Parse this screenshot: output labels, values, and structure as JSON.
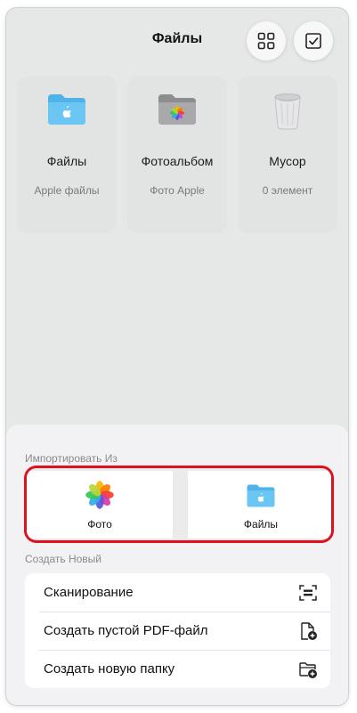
{
  "header": {
    "title": "Файлы"
  },
  "cards": [
    {
      "name": "Файлы",
      "sub": "Apple файлы"
    },
    {
      "name": "Фотоальбом",
      "sub": "Фото Apple"
    },
    {
      "name": "Мусор",
      "sub": "0 элемент"
    }
  ],
  "sheet": {
    "import_label": "Импортировать Из",
    "import_items": [
      {
        "label": "Фото"
      },
      {
        "label": "Файлы"
      }
    ],
    "create_label": "Создать Новый",
    "create_items": [
      {
        "label": "Сканирование",
        "icon": "scan-icon"
      },
      {
        "label": "Создать пустой PDF-файл",
        "icon": "add-document-icon"
      },
      {
        "label": "Создать новую папку",
        "icon": "add-folder-icon"
      }
    ]
  },
  "colors": {
    "highlight": "#e0101f",
    "folder_blue": "#5ab9ee",
    "background": "#e6e7e7"
  }
}
